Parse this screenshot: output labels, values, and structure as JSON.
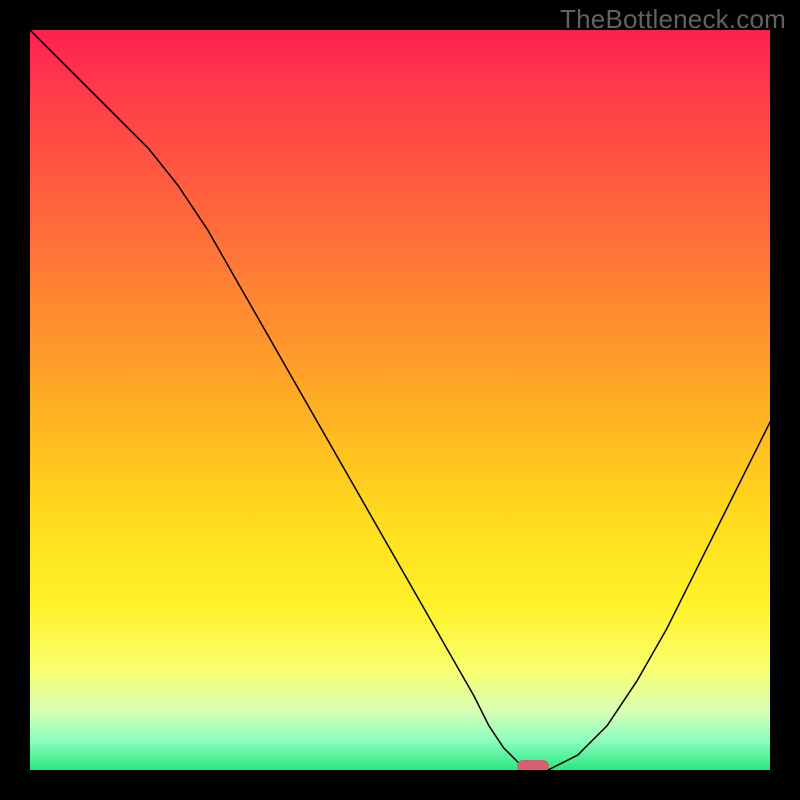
{
  "watermark": "TheBottleneck.com",
  "chart_data": {
    "type": "line",
    "title": "",
    "xlabel": "",
    "ylabel": "",
    "x_range": [
      0,
      100
    ],
    "y_range": [
      0,
      100
    ],
    "series": [
      {
        "name": "bottleneck-curve",
        "x": [
          0,
          4,
          8,
          12,
          16,
          20,
          24,
          28,
          32,
          36,
          40,
          44,
          48,
          52,
          56,
          60,
          62,
          64,
          66,
          68,
          70,
          74,
          78,
          82,
          86,
          90,
          94,
          98,
          100
        ],
        "y": [
          100,
          96,
          92,
          88,
          84,
          79,
          73,
          66,
          59,
          52,
          45,
          38,
          31,
          24,
          17,
          10,
          6,
          3,
          1,
          0,
          0,
          2,
          6,
          12,
          19,
          27,
          35,
          43,
          47
        ]
      }
    ],
    "marker": {
      "x": 68,
      "y": 0
    },
    "background_gradient": {
      "top": "#ff1f52",
      "mid": "#ffd21f",
      "bottom": "#29e77f"
    }
  }
}
